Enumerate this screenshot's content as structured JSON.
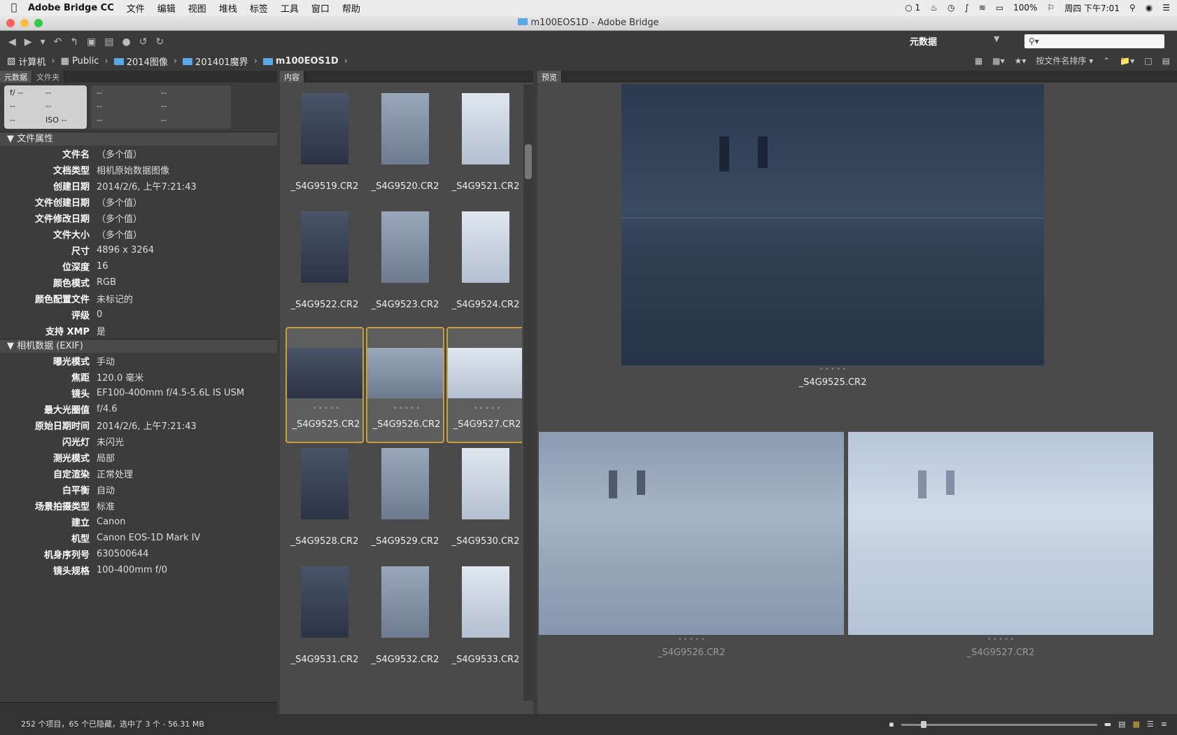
{
  "menubar": {
    "apple": "",
    "app": "Adobe Bridge CC",
    "items": [
      "文件",
      "编辑",
      "视图",
      "堆栈",
      "标签",
      "工具",
      "窗口",
      "帮助"
    ],
    "right": {
      "wechat": "1",
      "battery": "100%",
      "datetime": "周四 下午7:01"
    }
  },
  "window": {
    "title": "m100EOS1D - Adobe Bridge"
  },
  "toolbar": {
    "workspace": "元数据",
    "search_placeholder": ""
  },
  "path": {
    "crumbs": [
      "计算机",
      "Public",
      "2014图像",
      "201401魔界",
      "m100EOS1D"
    ],
    "sort_label": "按文件名排序"
  },
  "left": {
    "tabs": [
      "元数据",
      "文件夹"
    ],
    "camera": {
      "a": "f/ --",
      "b": "--",
      "c": "--",
      "d": "--",
      "e": "--",
      "f": "ISO --",
      "g": "--",
      "h": "--",
      "i": "--",
      "j": "--",
      "k": "--",
      "l": "--"
    },
    "file_props_title": "文件属性",
    "file_props": [
      [
        "文件名",
        "（多个值）"
      ],
      [
        "文档类型",
        "相机原始数据图像"
      ],
      [
        "创建日期",
        "2014/2/6, 上午7:21:43"
      ],
      [
        "文件创建日期",
        "（多个值）"
      ],
      [
        "文件修改日期",
        "（多个值）"
      ],
      [
        "文件大小",
        "（多个值）"
      ],
      [
        "尺寸",
        "4896 x 3264"
      ],
      [
        "位深度",
        "16"
      ],
      [
        "颜色模式",
        "RGB"
      ],
      [
        "颜色配置文件",
        "未标记的"
      ],
      [
        "评级",
        "0"
      ],
      [
        "支持 XMP",
        "是"
      ]
    ],
    "exif_title": "相机数据 (EXIF)",
    "exif": [
      [
        "曝光模式",
        "手动"
      ],
      [
        "焦距",
        "120.0 毫米"
      ],
      [
        "镜头",
        "EF100-400mm f/4.5-5.6L IS USM"
      ],
      [
        "最大光圈值",
        "f/4.6"
      ],
      [
        "原始日期时间",
        "2014/2/6, 上午7:21:43"
      ],
      [
        "闪光灯",
        "未闪光"
      ],
      [
        "测光模式",
        "局部"
      ],
      [
        "自定渲染",
        "正常处理"
      ],
      [
        "白平衡",
        "自动"
      ],
      [
        "场景拍摄类型",
        "标准"
      ],
      [
        "建立",
        "Canon"
      ],
      [
        "机型",
        "Canon EOS-1D Mark IV"
      ],
      [
        "机身序列号",
        "630500644"
      ],
      [
        "镜头规格",
        "100-400mm f/0"
      ]
    ]
  },
  "content": {
    "tab": "内容",
    "files": [
      "_S4G9519.CR2",
      "_S4G9520.CR2",
      "_S4G9521.CR2",
      "_S4G9522.CR2",
      "_S4G9523.CR2",
      "_S4G9524.CR2",
      "_S4G9525.CR2",
      "_S4G9526.CR2",
      "_S4G9527.CR2",
      "_S4G9528.CR2",
      "_S4G9529.CR2",
      "_S4G9530.CR2",
      "_S4G9531.CR2",
      "_S4G9532.CR2",
      "_S4G9533.CR2"
    ],
    "selected": [
      "_S4G9525.CR2",
      "_S4G9526.CR2",
      "_S4G9527.CR2"
    ],
    "rating_dots": "• • • • •"
  },
  "preview": {
    "tab": "预览",
    "main": "_S4G9525.CR2",
    "second": "_S4G9526.CR2",
    "third": "_S4G9527.CR2"
  },
  "status": {
    "text": "252 个项目，65 个已隐藏，选中了 3 个 - 56.31 MB"
  }
}
